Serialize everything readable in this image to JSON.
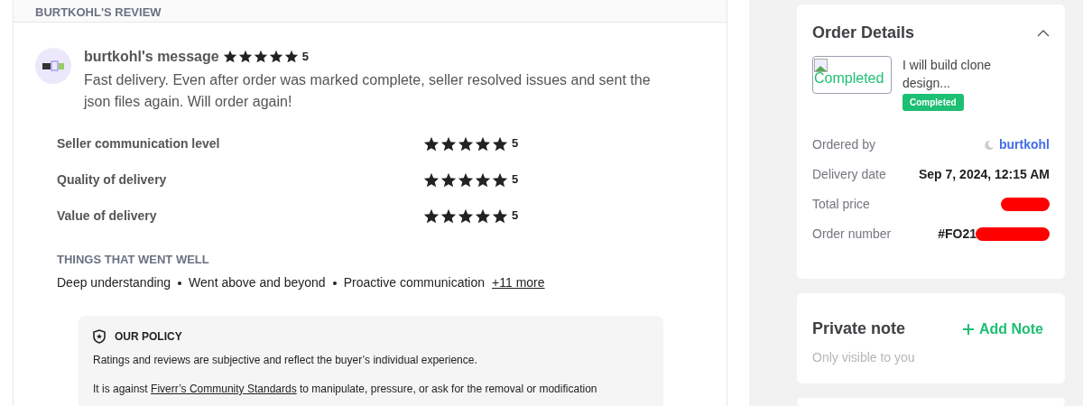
{
  "review": {
    "section_title": "BURTKOHL'S REVIEW",
    "author_message": "burtkohl's message",
    "stars": 5,
    "rating": "5",
    "text": "Fast delivery. Even after order was marked complete, seller resolved issues and sent the json files again. Will order again!",
    "ratings": [
      {
        "label": "Seller communication level",
        "stars": 5,
        "rating": "5"
      },
      {
        "label": "Quality of delivery",
        "stars": 5,
        "rating": "5"
      },
      {
        "label": "Value of delivery",
        "stars": 5,
        "rating": "5"
      }
    ],
    "went_well_title": "THINGS THAT WENT WELL",
    "went_well": [
      "Deep understanding",
      "Went above and beyond",
      "Proactive communication"
    ],
    "more_link": "+11 more",
    "policy": {
      "title": "OUR POLICY",
      "line_1": "Ratings and reviews are subjective and reflect the buyer’s individual experience.",
      "line_2_before": "It is against",
      "line_2_link": "Fiverr’s Community Standards",
      "line_2_after": "to manipulate, pressure, or ask for the removal or modification"
    }
  },
  "order_details": {
    "title": "Order Details",
    "expanded": true,
    "image_alt": "Completed",
    "gig_title": "I will build clone design...",
    "status": "Completed",
    "rows": [
      {
        "label": "Ordered by",
        "value": "burtkohl",
        "kind": "user"
      },
      {
        "label": "Delivery date",
        "value": "Sep 7, 2024, 12:15 AM",
        "kind": "text"
      },
      {
        "label": "Total price",
        "kind": "redacted"
      },
      {
        "label": "Order number",
        "value": "#FO21",
        "kind": "partly_redacted"
      }
    ]
  },
  "private_note": {
    "title": "Private note",
    "action": "Add Note",
    "hint": "Only visible to you"
  }
}
